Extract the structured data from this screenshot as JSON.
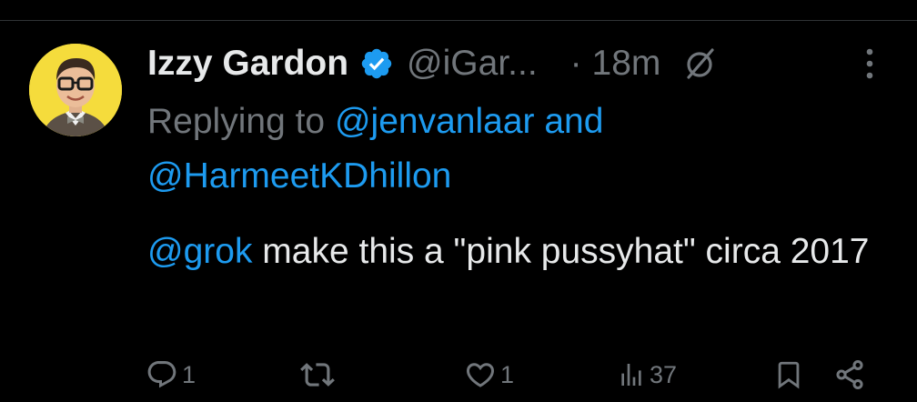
{
  "tweet": {
    "author": {
      "display_name": "Izzy Gardon",
      "handle": "@iGar...",
      "verified": true
    },
    "time_sep": "·",
    "time": "18m",
    "replying_prefix": "Replying to",
    "reply_mentions": [
      "@jenvanlaar",
      "@HarmeetKDhillon"
    ],
    "reply_joiner": "and",
    "text_mention": "@grok",
    "text_rest": " make this a \"pink pussyhat\" circa 2017",
    "actions": {
      "replies": "1",
      "retweets": "",
      "likes": "1",
      "views": "37"
    }
  },
  "colors": {
    "background": "#000000",
    "text": "#e7e9ea",
    "muted": "#71767b",
    "accent": "#1d9bf0",
    "avatar_bg": "#f5dc3c"
  },
  "icons": [
    "verified-badge-icon",
    "grok-icon",
    "more-icon",
    "reply-icon",
    "retweet-icon",
    "like-icon",
    "views-icon",
    "bookmark-icon",
    "share-icon"
  ]
}
